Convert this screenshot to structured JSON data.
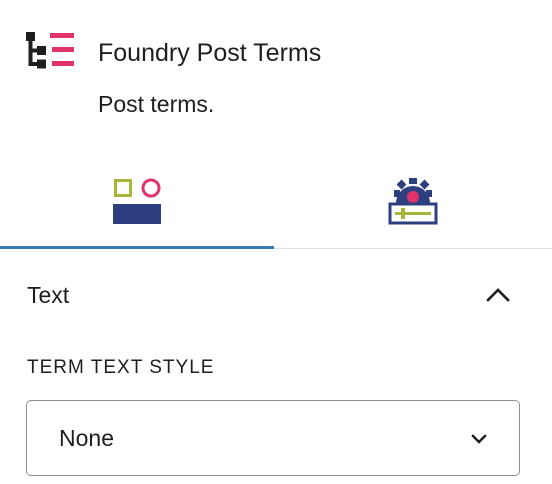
{
  "block": {
    "title": "Foundry Post Terms",
    "description": "Post terms."
  },
  "tabs": [
    {
      "name": "styles-tab",
      "icon": "shapes-styles-icon",
      "active": true
    },
    {
      "name": "advanced-tab",
      "icon": "gear-settings-icon",
      "active": false
    }
  ],
  "panel": {
    "title": "Text",
    "expanded": true,
    "field": {
      "label": "TERM TEXT STYLE",
      "value": "None"
    }
  },
  "colors": {
    "accent": "#3a78b5",
    "brand_pink": "#e2336b",
    "brand_navy": "#2d3f7e",
    "brand_olive": "#a9b53a"
  }
}
